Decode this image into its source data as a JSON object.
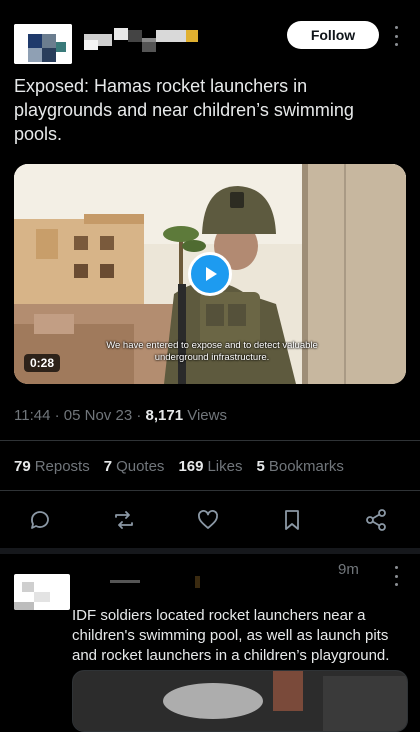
{
  "header": {
    "follow_label": "Follow"
  },
  "tweet": {
    "text": "Exposed: Hamas rocket launchers in playgrounds and near children’s swimming pools.",
    "video": {
      "duration": "0:28",
      "caption": "We have entered to expose and to detect valuable underground infrastructure."
    },
    "time": "11:44",
    "date": "05 Nov 23",
    "views_count": "8,171",
    "views_label": "Views"
  },
  "stats": [
    {
      "count": "79",
      "label": "Reposts"
    },
    {
      "count": "7",
      "label": "Quotes"
    },
    {
      "count": "169",
      "label": "Likes"
    },
    {
      "count": "5",
      "label": "Bookmarks"
    }
  ],
  "icons": {
    "reply": "reply-icon",
    "repost": "repost-icon",
    "like": "heart-icon",
    "bookmark": "bookmark-icon",
    "share": "share-icon"
  },
  "reply": {
    "time": "9m",
    "text": "IDF soldiers located rocket launchers near a children's swimming pool, as well as launch pits and rocket launchers in a children’s playground."
  },
  "colors": {
    "background": "#000000",
    "text": "#e7e9ea",
    "muted": "#71767b",
    "accent": "#1d9bf0"
  }
}
